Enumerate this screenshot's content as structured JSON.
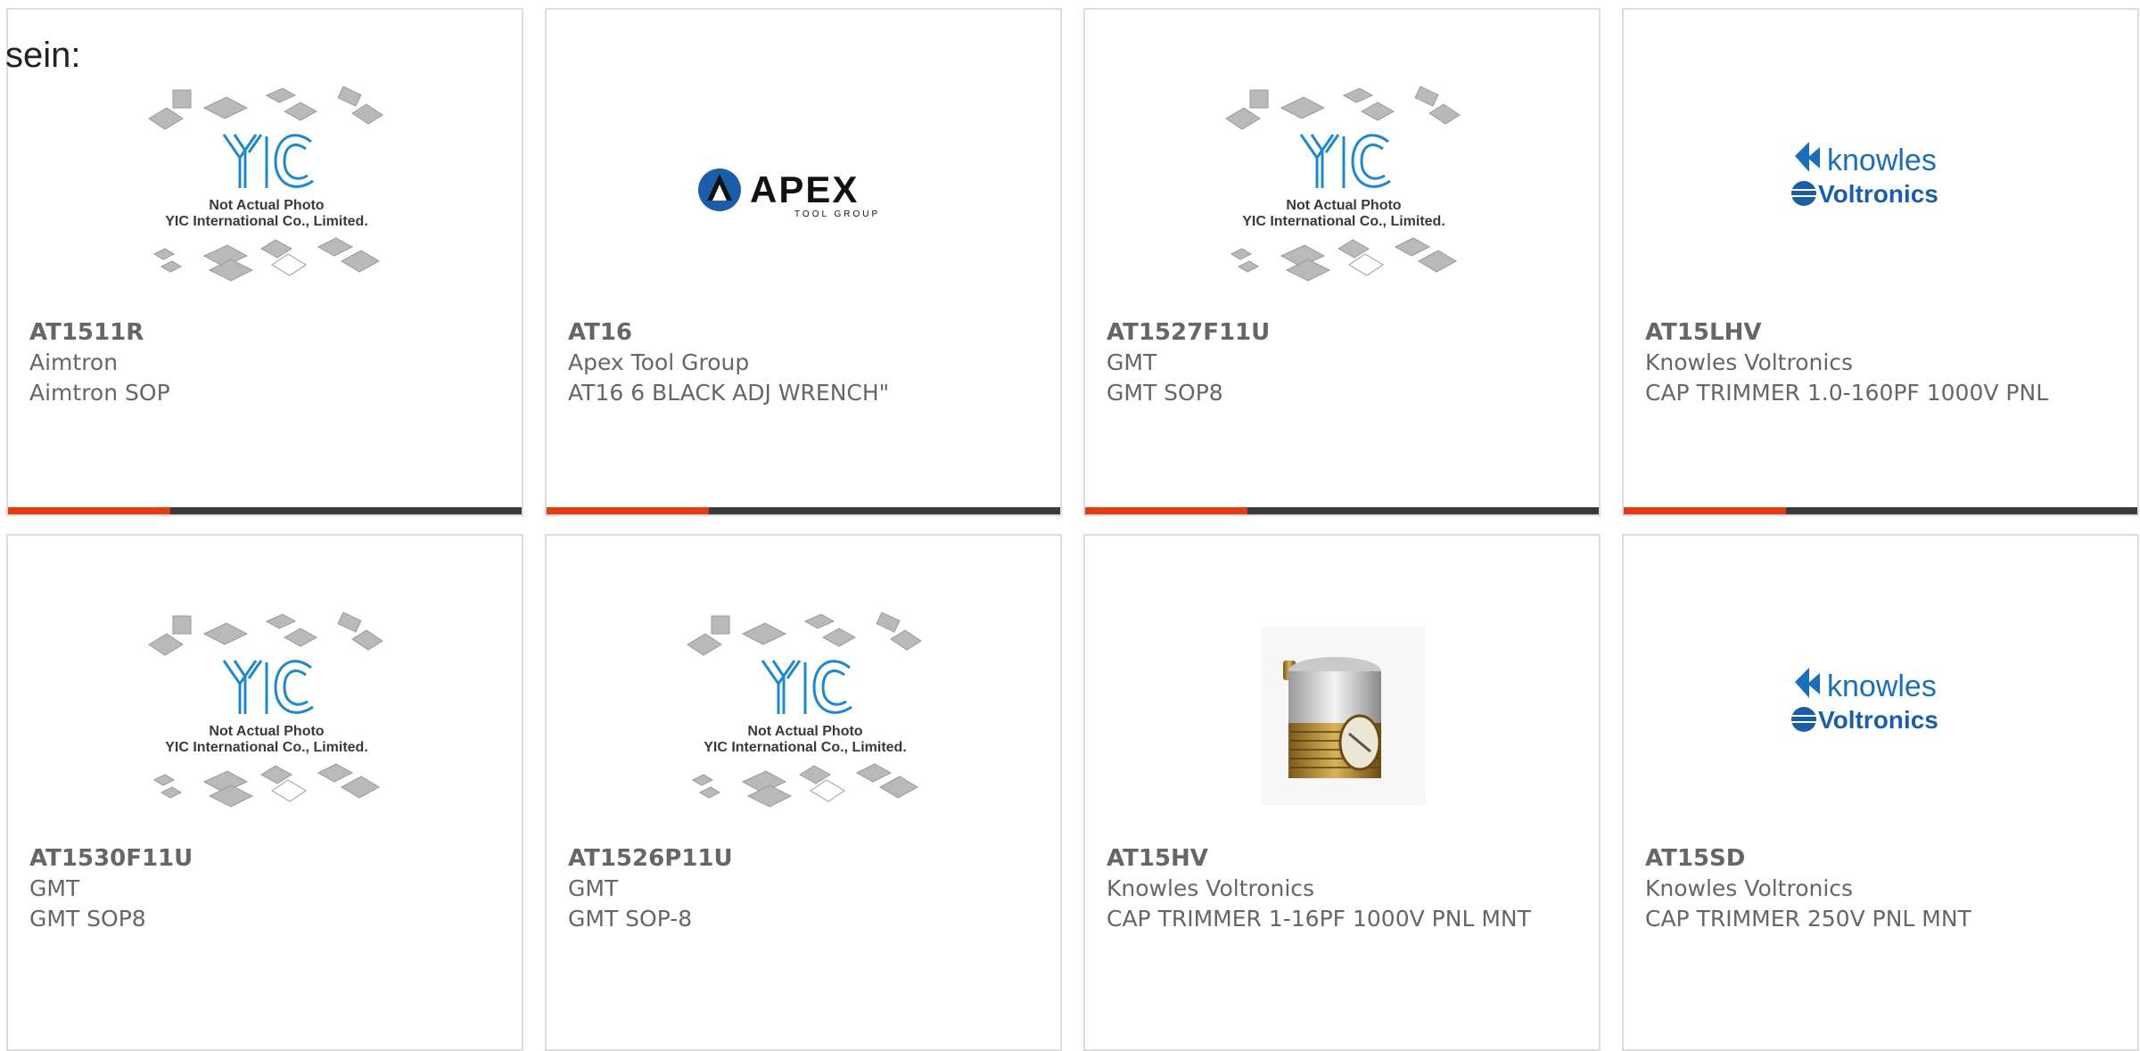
{
  "intro_text": "sein:",
  "colors": {
    "accent": "#e63b12",
    "bar": "#3a3a3a",
    "border": "#dcdcdc",
    "text": "#666666"
  },
  "placeholder": {
    "line1": "Not Actual Photo",
    "line2": "YIC International Co., Limited.",
    "logo": "YIC"
  },
  "brand_logos": {
    "apex": {
      "name": "APEX",
      "sub": "TOOL GROUP"
    },
    "knowles": {
      "line1": "knowles",
      "line2": "Voltronics"
    }
  },
  "products": [
    {
      "part": "AT1511R",
      "manufacturer": "Aimtron",
      "description": "Aimtron SOP",
      "image": "yic-placeholder"
    },
    {
      "part": "AT16",
      "manufacturer": "Apex Tool Group",
      "description": "AT16 6 BLACK ADJ WRENCH\"",
      "image": "apex-logo"
    },
    {
      "part": "AT1527F11U",
      "manufacturer": "GMT",
      "description": "GMT SOP8",
      "image": "yic-placeholder"
    },
    {
      "part": "AT15LHV",
      "manufacturer": "Knowles Voltronics",
      "description": "CAP TRIMMER 1.0-160PF 1000V PNL",
      "image": "knowles-logo"
    },
    {
      "part": "AT1530F11U",
      "manufacturer": "GMT",
      "description": "GMT SOP8",
      "image": "yic-placeholder"
    },
    {
      "part": "AT1526P11U",
      "manufacturer": "GMT",
      "description": "GMT SOP-8",
      "image": "yic-placeholder"
    },
    {
      "part": "AT15HV",
      "manufacturer": "Knowles Voltronics",
      "description": "CAP TRIMMER 1-16PF 1000V PNL MNT",
      "image": "trimmer-photo"
    },
    {
      "part": "AT15SD",
      "manufacturer": "Knowles Voltronics",
      "description": "CAP TRIMMER 250V PNL MNT",
      "image": "knowles-logo"
    }
  ]
}
